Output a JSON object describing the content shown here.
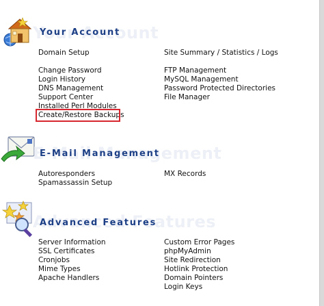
{
  "account": {
    "ghost_title": "Your Account",
    "title": "Your Account",
    "left_links": [
      "Domain Setup",
      "Change Password",
      "Login History",
      "DNS Management",
      "Support Center",
      "Installed Perl Modules",
      "Create/Restore Backups"
    ],
    "right_links": [
      "Site Summary / Statistics / Logs",
      "FTP Management",
      "MySQL Management",
      "Password Protected Directories",
      "File Manager"
    ]
  },
  "email": {
    "ghost_title": "E-Mail Management",
    "title": "E-Mail Management",
    "left_links": [
      "Autoresponders",
      "Spamassassin Setup"
    ],
    "right_links": [
      "MX Records"
    ]
  },
  "advanced": {
    "ghost_title": "Advanced Features",
    "title": "Advanced Features",
    "left_links": [
      "Server Information",
      "SSL Certificates",
      "Cronjobs",
      "Mime Types",
      "Apache Handlers"
    ],
    "right_links": [
      "Custom Error Pages",
      "phpMyAdmin",
      "Site Redirection",
      "Hotlink Protection",
      "Domain Pointers",
      "Login Keys"
    ]
  },
  "colors": {
    "title": "#1d3f86",
    "highlight": "#d7262d"
  },
  "icons": [
    "house-globe-icon",
    "envelope-arrow-icon",
    "stars-magnifier-icon"
  ]
}
